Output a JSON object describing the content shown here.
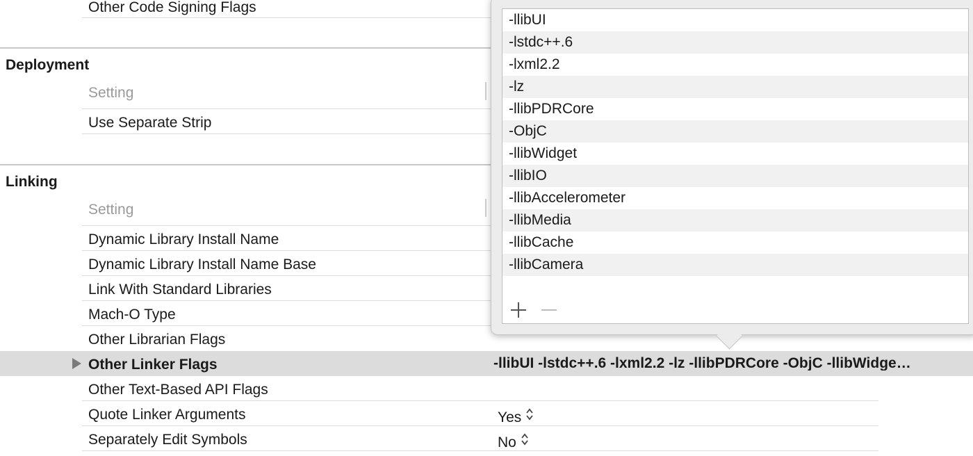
{
  "signing": {
    "other_code_signing_flags": "Other Code Signing Flags"
  },
  "deployment": {
    "title": "Deployment",
    "column_header": "Setting",
    "rows": [
      "Use Separate Strip"
    ]
  },
  "linking": {
    "title": "Linking",
    "column_header": "Setting",
    "rows": [
      "Dynamic Library Install Name",
      "Dynamic Library Install Name Base",
      "Link With Standard Libraries",
      "Mach-O Type",
      "Other Librarian Flags"
    ],
    "selected_row": {
      "label": "Other Linker Flags",
      "value": "-llibUI -lstdc++.6 -lxml2.2 -lz -llibPDRCore -ObjC -llibWidge…"
    },
    "rows_after": [
      {
        "label": "Other Text-Based API Flags",
        "value": ""
      },
      {
        "label": "Quote Linker Arguments",
        "value": "Yes"
      },
      {
        "label": "Separately Edit Symbols",
        "value": "No"
      }
    ],
    "stepper_glyph": "⌃⌄"
  },
  "popover": {
    "flags": [
      "-llibUI",
      "-lstdc++.6",
      "-lxml2.2",
      "-lz",
      "-llibPDRCore",
      "-ObjC",
      "-llibWidget",
      "-llibIO",
      "-llibAccelerometer",
      "-llibMedia",
      "-llibCache",
      "-llibCamera"
    ],
    "add_icon": "plus-icon",
    "remove_icon": "minus-icon"
  }
}
